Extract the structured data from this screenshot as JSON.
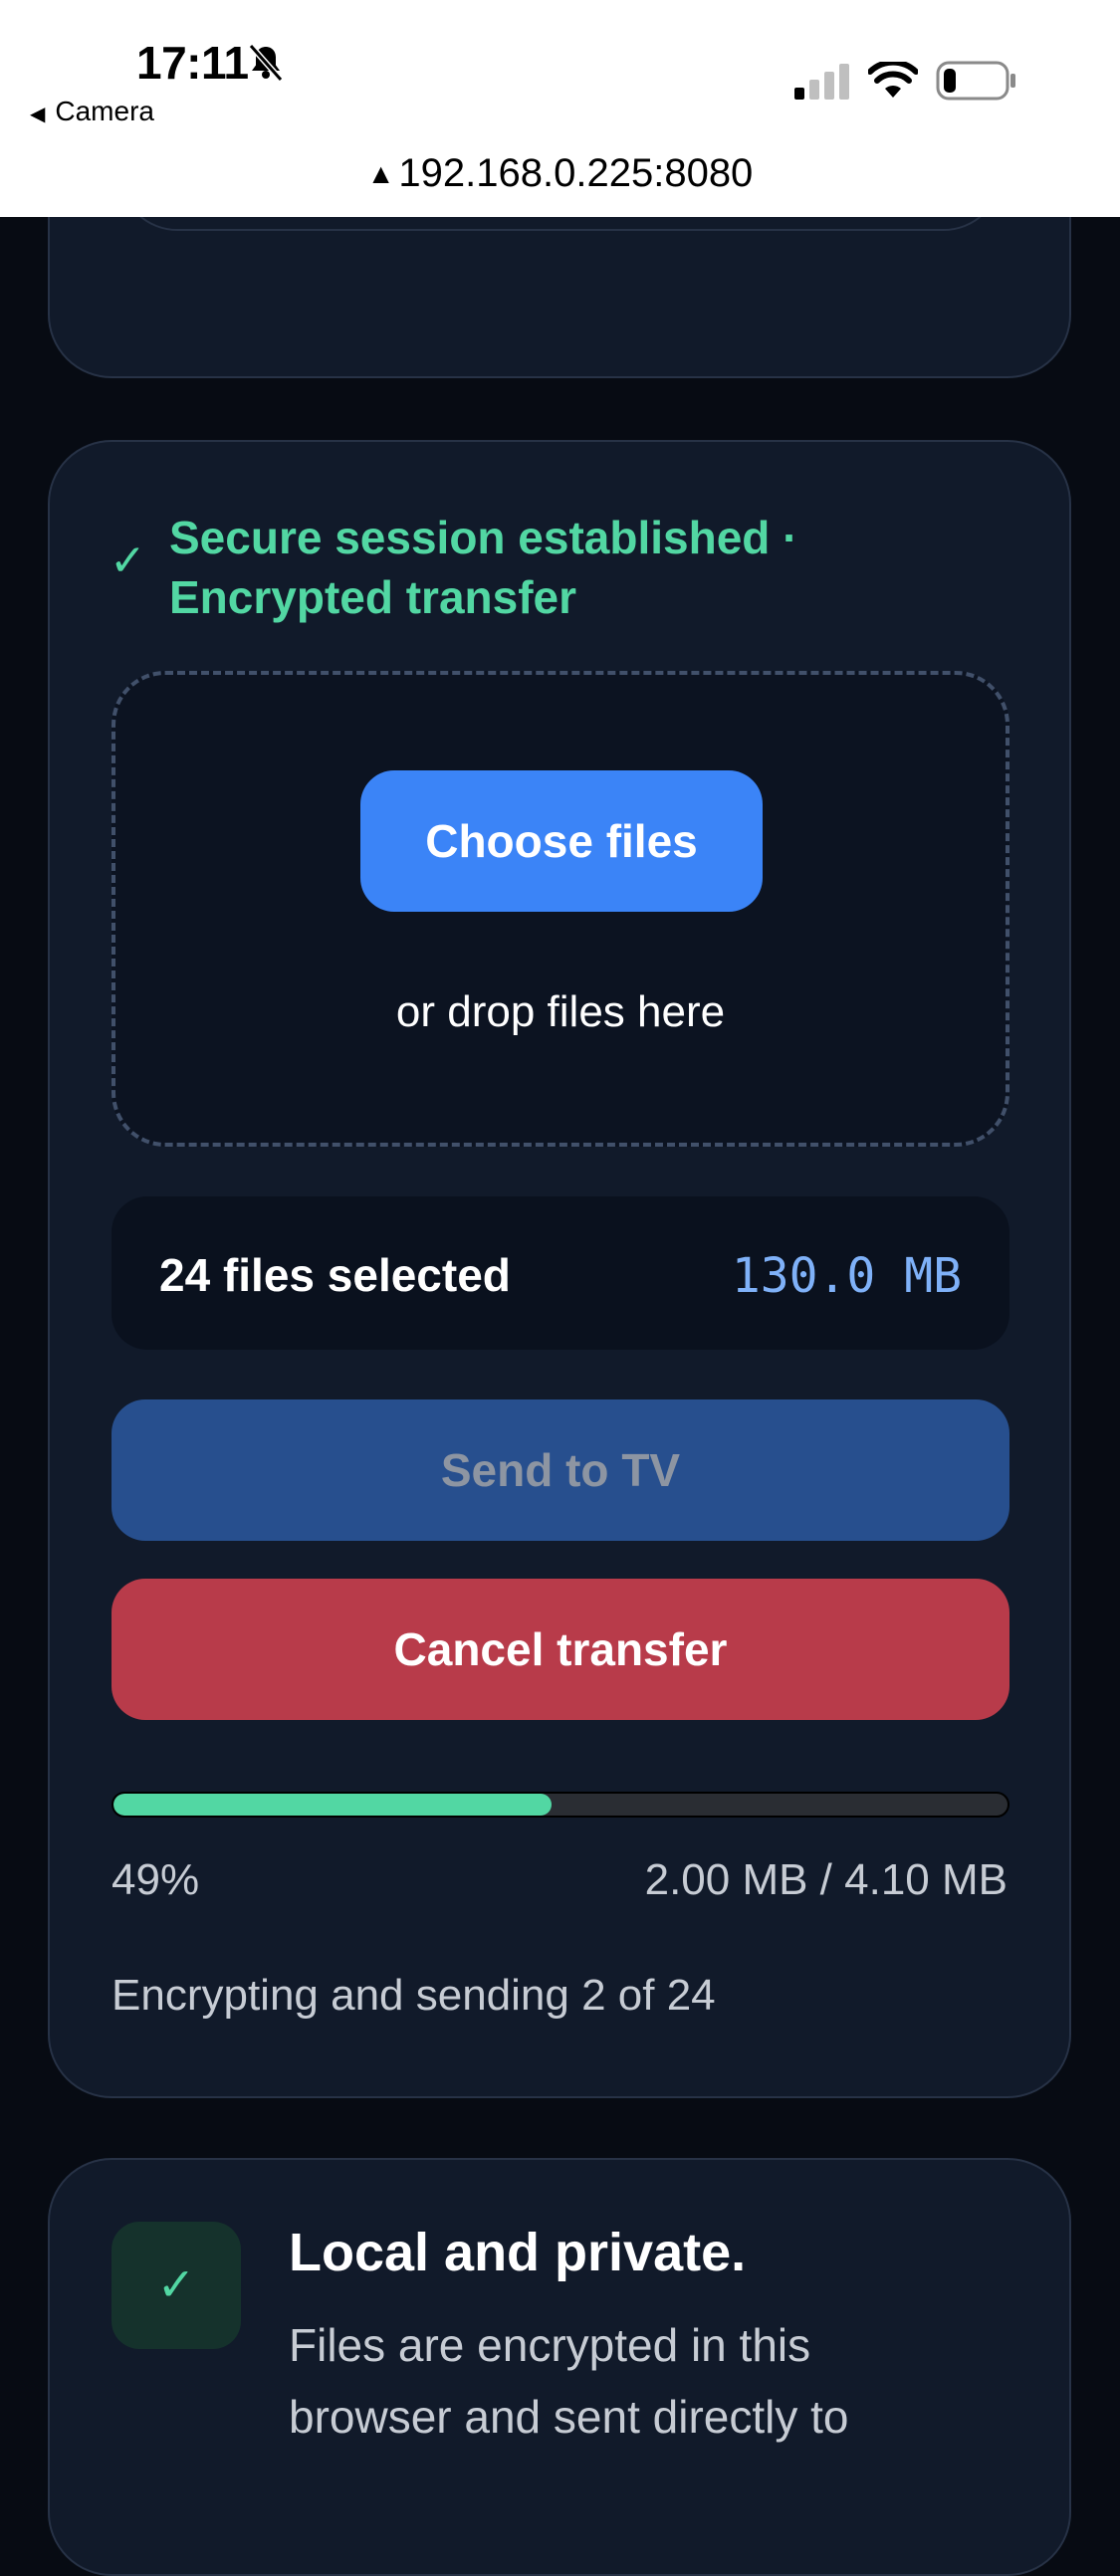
{
  "status_bar": {
    "time": "17:11",
    "back_app": "Camera",
    "url": "192.168.0.225:8080"
  },
  "session": {
    "status_text": "Secure session established · Encrypted transfer",
    "check_glyph": "✓"
  },
  "dropzone": {
    "choose_label": "Choose files",
    "hint": "or drop files here"
  },
  "selection": {
    "count_label": "24 files selected",
    "size_label": "130.0 MB"
  },
  "actions": {
    "send_label": "Send to TV",
    "cancel_label": "Cancel transfer"
  },
  "progress": {
    "fraction": 0.49,
    "percent_label": "49%",
    "bytes_label": "2.00 MB / 4.10 MB",
    "status": "Encrypting and sending 2 of 24"
  },
  "info": {
    "check_glyph": "✓",
    "title": "Local and private.",
    "text": "Files are encrypted in this browser and sent directly to"
  },
  "colors": {
    "accent_green": "#52d7a3",
    "primary_blue": "#3b84f7",
    "danger_red": "#b83b4a",
    "background": "#070b13",
    "card": "#111a2a"
  },
  "icons": {
    "bell": "bell-slash-icon",
    "signal": "cellular-signal-icon",
    "wifi": "wifi-icon",
    "battery": "battery-low-icon",
    "warning": "warning-triangle-icon",
    "back": "back-arrow-icon",
    "check": "check-icon"
  }
}
